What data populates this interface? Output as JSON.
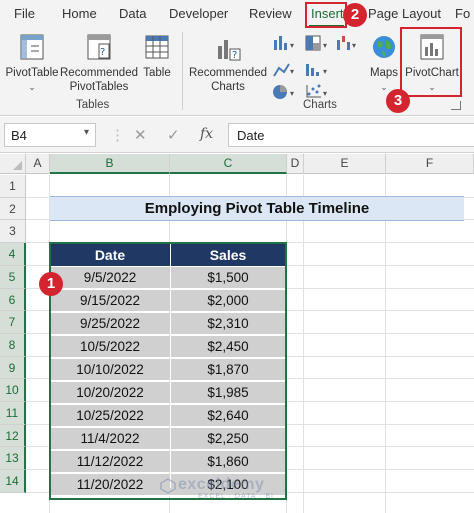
{
  "ribbon_tabs": [
    "File",
    "Home",
    "Data",
    "Developer",
    "Review",
    "Insert",
    "Page Layout",
    "Fo"
  ],
  "ribbon": {
    "pivottable": "PivotTable",
    "recommended_pivottables_1": "Recommended",
    "recommended_pivottables_2": "PivotTables",
    "table": "Table",
    "tables_group": "Tables",
    "recommended_charts_1": "Recommended",
    "recommended_charts_2": "Charts",
    "maps": "Maps",
    "pivotchart": "PivotChart",
    "charts_group": "Charts"
  },
  "formula_bar": {
    "name_box": "B4",
    "cancel": "✕",
    "enter": "✓",
    "fx": "fx",
    "formula": "Date"
  },
  "columns": [
    "A",
    "B",
    "C",
    "D",
    "E",
    "F"
  ],
  "rows": [
    "1",
    "2",
    "3",
    "4",
    "5",
    "6",
    "7",
    "8",
    "9",
    "10",
    "11",
    "12",
    "13",
    "14"
  ],
  "sheet": {
    "title": "Employing Pivot Table Timeline",
    "headers": [
      "Date",
      "Sales"
    ],
    "data": [
      [
        "9/5/2022",
        "$1,500"
      ],
      [
        "9/15/2022",
        "$2,000"
      ],
      [
        "9/25/2022",
        "$2,310"
      ],
      [
        "10/5/2022",
        "$2,450"
      ],
      [
        "10/10/2022",
        "$1,870"
      ],
      [
        "10/20/2022",
        "$1,985"
      ],
      [
        "10/25/2022",
        "$2,640"
      ],
      [
        "11/4/2022",
        "$2,250"
      ],
      [
        "11/12/2022",
        "$1,860"
      ],
      [
        "11/20/2022",
        "$2,100"
      ]
    ]
  },
  "callouts": [
    "1",
    "2",
    "3"
  ],
  "watermark": {
    "main": "exceldemy",
    "sub": "EXCEL · DATA · BI"
  },
  "colors": {
    "accent": "#217346",
    "header_fill": "#1f3864",
    "callout": "#d3242f"
  }
}
